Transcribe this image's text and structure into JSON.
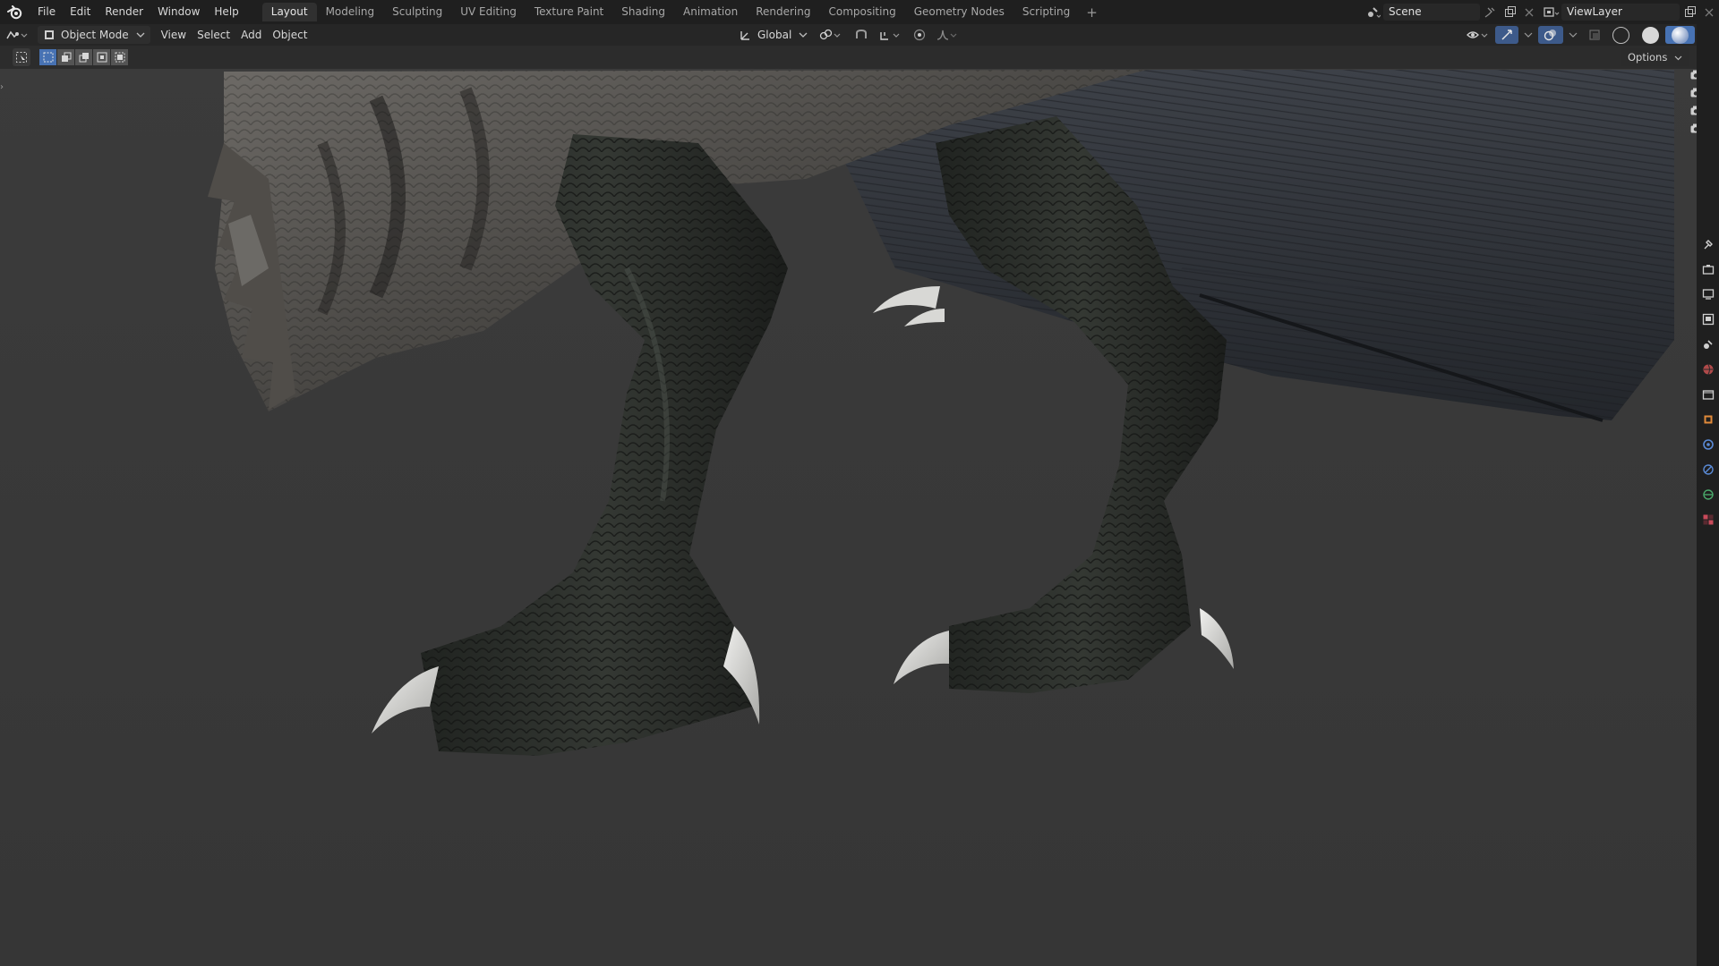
{
  "menu": {
    "items": [
      "File",
      "Edit",
      "Render",
      "Window",
      "Help"
    ]
  },
  "workspaces": {
    "tabs": [
      "Layout",
      "Modeling",
      "Sculpting",
      "UV Editing",
      "Texture Paint",
      "Shading",
      "Animation",
      "Rendering",
      "Compositing",
      "Geometry Nodes",
      "Scripting"
    ],
    "active": "Layout",
    "add_label": "+"
  },
  "scene": {
    "name": "Scene"
  },
  "view_layer": {
    "name": "ViewLayer"
  },
  "viewport_header": {
    "mode": "Object Mode",
    "menus": [
      "View",
      "Select",
      "Add",
      "Object"
    ],
    "orientation": "Global"
  },
  "tool_settings": {
    "options_label": "Options"
  },
  "colors": {
    "accent": "#4772b3",
    "topbar": "#1f1f1f",
    "viewport_bg": "#393939"
  },
  "icons": {
    "gizmo": [
      "camera-icon",
      "camera-icon",
      "camera-icon",
      "camera-icon"
    ],
    "properties": [
      "tool-icon",
      "render-icon",
      "output-icon",
      "view-layer-icon",
      "scene-icon",
      "world-icon",
      "collection-icon",
      "object-icon",
      "modifier-icon",
      "particles-icon",
      "physics-icon",
      "constraint-icon",
      "data-icon",
      "texture-icon"
    ]
  }
}
